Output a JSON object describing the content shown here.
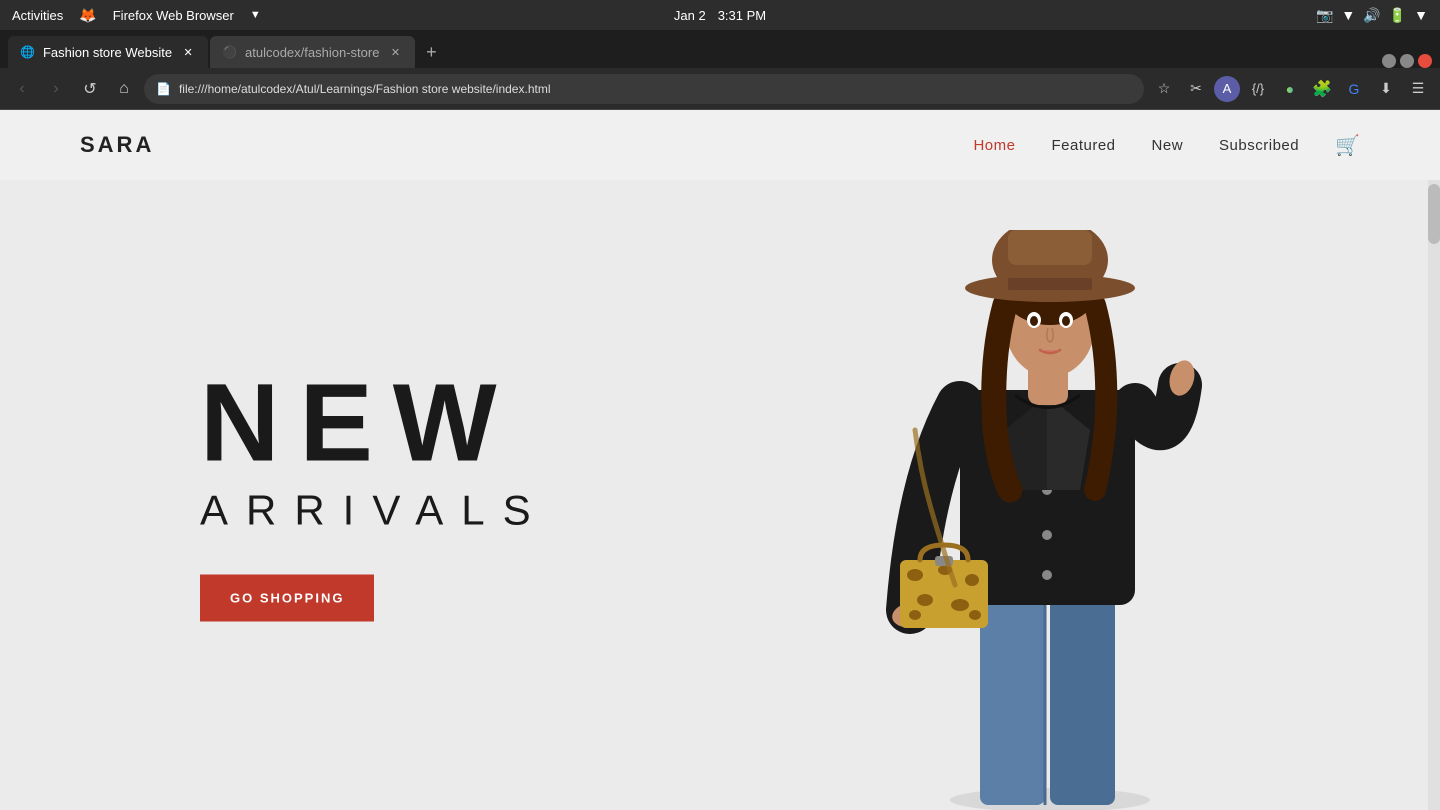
{
  "os": {
    "activities_label": "Activities",
    "browser_label": "Firefox Web Browser",
    "date": "Jan 2",
    "time": "3:31 PM"
  },
  "browser": {
    "tabs": [
      {
        "id": "tab-1",
        "title": "Fashion store Website",
        "favicon": "🌐",
        "active": true
      },
      {
        "id": "tab-2",
        "title": "atulcodex/fashion-store",
        "favicon": "⚫",
        "active": false
      }
    ],
    "url": "file:///home/atulcodex/Atul/Learnings/Fashion store website/index.html",
    "new_tab_label": "+"
  },
  "website": {
    "logo": "SARA",
    "nav": {
      "links": [
        {
          "label": "Home",
          "active": true
        },
        {
          "label": "Featured",
          "active": false
        },
        {
          "label": "New",
          "active": false
        },
        {
          "label": "Subscribed",
          "active": false
        }
      ]
    },
    "hero": {
      "line1": "NEW",
      "line2": "ARRIVALS",
      "cta_label": "GO SHOPPING"
    },
    "accent_color": "#c0392b"
  }
}
